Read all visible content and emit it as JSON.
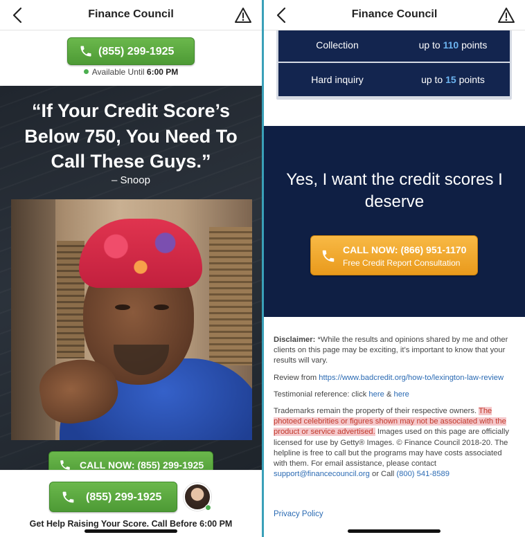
{
  "app": {
    "title": "Finance Council"
  },
  "left": {
    "top_call": {
      "phone": "(855) 299-1925",
      "availability_prefix": "Available Until",
      "availability_time": "6:00 PM"
    },
    "hero": {
      "quote_lines": [
        "“If Your Credit Score’s",
        "Below 750, You Need To",
        "Call These Guys.”"
      ],
      "attribution": "– Snoop",
      "call_button": "CALL NOW: (855) 299-1925"
    },
    "footer": {
      "phone": "(855) 299-1925",
      "text": "Get Help Raising Your Score. Call Before 6:00 PM"
    }
  },
  "right": {
    "points_table": [
      {
        "label": "Collection",
        "prefix": "up to",
        "value": "110",
        "suffix": "points"
      },
      {
        "label": "Hard inquiry",
        "prefix": "up to",
        "value": "15",
        "suffix": "points"
      }
    ],
    "cta": {
      "heading": "Yes, I want the credit scores I deserve",
      "button_line1": "CALL NOW: (866) 951-1170",
      "button_line2": "Free Credit Report Consultation"
    },
    "disclaimer": {
      "label": "Disclaimer:",
      "text": "*While the results and opinions shared by me and other clients on this page may be exciting, it’s important to know that your results will vary.",
      "review_prefix": "Review from",
      "review_link": "https://www.badcredit.org/how-to/lexington-law-review",
      "testimonial_prefix": "Testimonial reference: click",
      "here1": "here",
      "amp": "&",
      "here2": "here",
      "trademark_text": "Trademarks remain the property of their respective owners.",
      "highlight_text": "The photoed celebrities or figures shown may not be associated with the product or service advertised.",
      "images_text": "Images used on this page are officially licensed for use by Getty® Images. © Finance Council 2018-20. The helpline is free to call but the programs may have costs associated with them. For email assistance, please contact",
      "email": "support@financecouncil.org",
      "or_call": "or Call",
      "support_phone": "(800) 541-8589",
      "privacy": "Privacy Policy"
    }
  },
  "colors": {
    "green": "#5aa83e",
    "navy": "#0f1f44",
    "orange": "#f0a52b",
    "highlight": "#f5c9cc"
  },
  "icons": [
    "back-icon",
    "warning-icon",
    "phone-icon"
  ]
}
